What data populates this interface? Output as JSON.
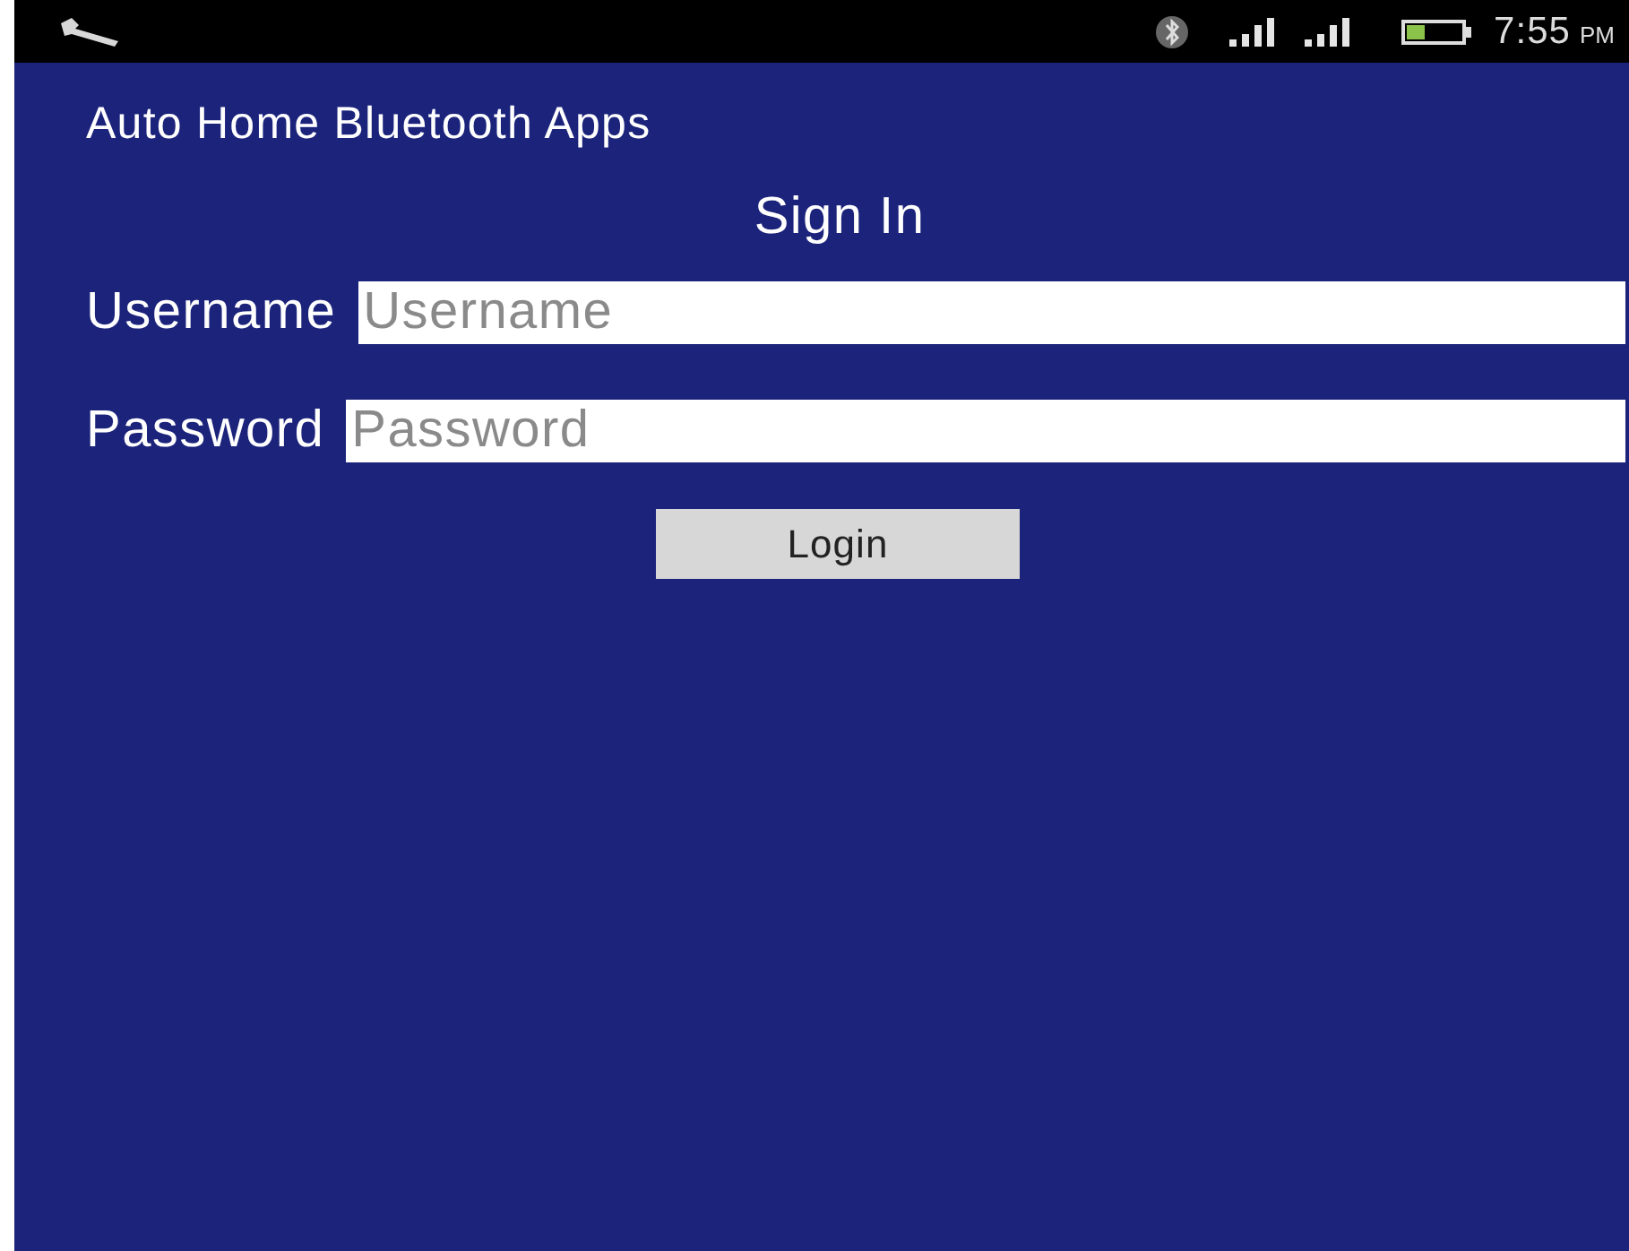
{
  "status_bar": {
    "time": "7:55",
    "meridiem": "PM"
  },
  "app_title": "Auto Home Bluetooth Apps",
  "heading": "Sign In",
  "fields": [
    {
      "label": "Username",
      "placeholder": "Username"
    },
    {
      "label": "Password",
      "placeholder": "Password"
    }
  ],
  "login_button": "Login"
}
